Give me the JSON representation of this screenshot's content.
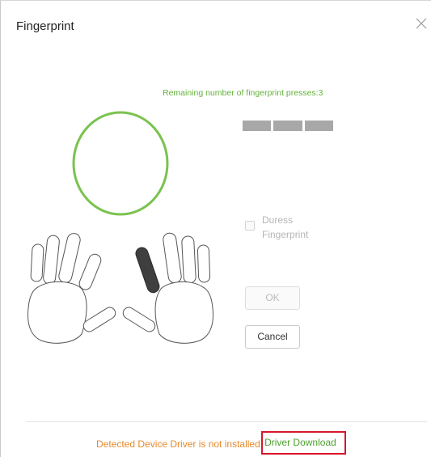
{
  "dialog": {
    "title": "Fingerprint",
    "close_icon": "close-icon",
    "remaining_text": "Remaining number of fingerprint presses:3",
    "remaining_presses": 3,
    "progress_segments": 3,
    "duress_label": "Duress Fingerprint",
    "duress_checked": false,
    "ok_label": "OK",
    "cancel_label": "Cancel",
    "footer_warning": "Detected Device Driver is not installed:",
    "footer_link": "Driver Download",
    "selected_finger": "right-index-finger"
  },
  "colors": {
    "accent_green": "#63b23a",
    "oval_green": "#7bc24f",
    "warning_orange": "#e58a2b",
    "link_green": "#4ca12d",
    "highlight_red": "#d7162a",
    "segment_gray": "#a8a8a8",
    "selected_finger": "#3f3f3f"
  }
}
